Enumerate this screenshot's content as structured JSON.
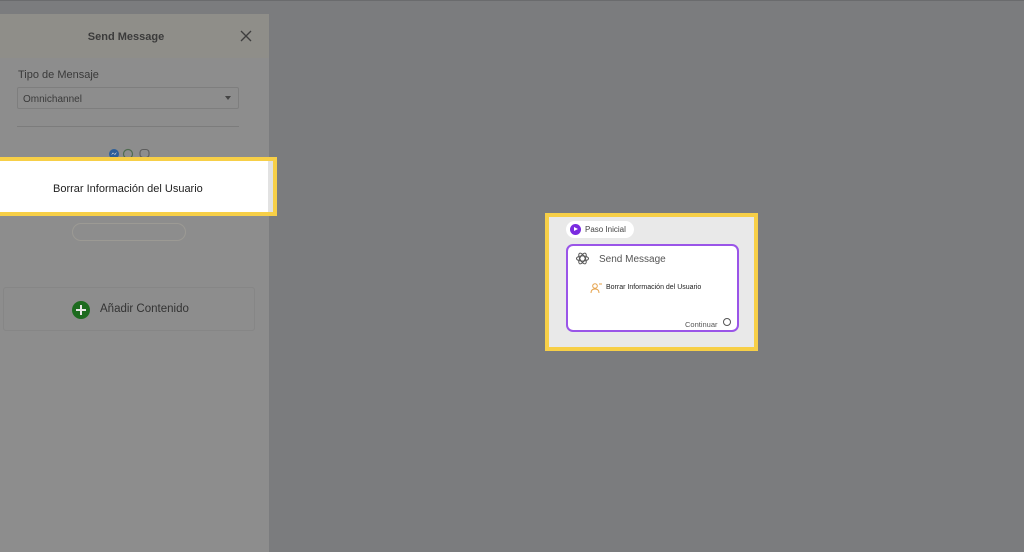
{
  "panel": {
    "title": "Send Message",
    "message_type_label": "Tipo de Mensaje",
    "message_type_value": "Omnichannel",
    "add_content_label": "Añadir Contenido"
  },
  "highlight": {
    "item_label": "Borrar Información del Usuario"
  },
  "node": {
    "start_label": "Paso Inicial",
    "title": "Send Message",
    "item_label": "Borrar Información del Usuario",
    "continue_label": "Continuar"
  },
  "colors": {
    "highlight": "#f7cf47",
    "node_border": "#9a55e8",
    "start_icon": "#7a2ae0",
    "add_icon": "#1d6b1f"
  }
}
